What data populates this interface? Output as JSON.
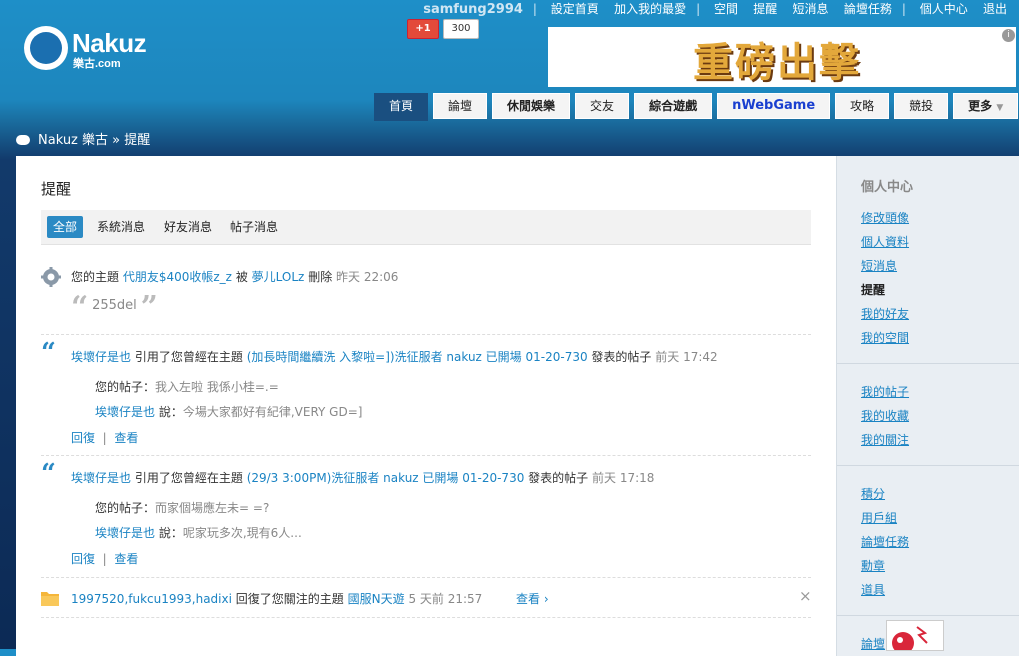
{
  "header": {
    "logo_text": "Nakuz",
    "logo_sub": "樂古.com",
    "user": "samfung2994",
    "links": [
      "設定首頁",
      "加入我的最愛",
      "空間",
      "提醒",
      "短消息",
      "論壇任務",
      "個人中心",
      "退出"
    ],
    "gplus_label": "+1",
    "gplus_count": "300",
    "banner_text": "重磅出擊",
    "banner_info": "i"
  },
  "tabs": [
    {
      "label": "首頁",
      "active": true
    },
    {
      "label": "論壇"
    },
    {
      "label": "休閒娛樂"
    },
    {
      "label": "交友"
    },
    {
      "label": "綜合遊戲"
    },
    {
      "label": "nWebGame"
    },
    {
      "label": "攻略"
    },
    {
      "label": "競投"
    },
    {
      "label": "更多"
    }
  ],
  "breadcrumb": {
    "site": "Nakuz 樂古",
    "sep": "»",
    "current": "提醒"
  },
  "page": {
    "title": "提醒",
    "filters": [
      "全部",
      "系統消息",
      "好友消息",
      "帖子消息"
    ]
  },
  "notifications": [
    {
      "prefix": "您的主題",
      "topic": "代朋友$400收帳z_z",
      "by_word": "被",
      "user": "夢儿LOLz",
      "action": "刪除",
      "time": "昨天 22:06",
      "quote": "255del"
    },
    {
      "user": "埃壞仔是也",
      "text1": "引用了您曾經在主題",
      "topic": "(加長時間繼續洗 入黎啦=])洗征服者 nakuz 已開場 01-20-730",
      "text2": "發表的帖子",
      "time": "前天 17:42",
      "your_post_label": "您的帖子：",
      "your_post": "我入左啦 我係小桂=.=",
      "reply_user": "埃壞仔是也",
      "said": "說：",
      "reply": "今場大家都好有紀律,VERY GD=]",
      "reply_link": "回復",
      "view_link": "查看"
    },
    {
      "user": "埃壞仔是也",
      "text1": "引用了您曾經在主題",
      "topic": "(29/3 3:00PM)洗征服者 nakuz 已開場 01-20-730",
      "text2": "發表的帖子",
      "time": "前天 17:18",
      "your_post_label": "您的帖子：",
      "your_post": "而家個場應左未= =?",
      "reply_user": "埃壞仔是也",
      "said": "說：",
      "reply": "呢家玩多次,現有6人...",
      "reply_link": "回復",
      "view_link": "查看"
    },
    {
      "users": "1997520,fukcu1993,hadixi",
      "text1": "回復了您關注的主題",
      "topic": "國服N天遊",
      "time": "5 天前 21:57",
      "view_link": "查看 ›",
      "close": "×"
    }
  ],
  "sidebar": {
    "title": "個人中心",
    "group1": [
      "修改頭像",
      "個人資料",
      "短消息",
      "提醒",
      "我的好友",
      "我的空間"
    ],
    "group2": [
      "我的帖子",
      "我的收藏",
      "我的關注"
    ],
    "group3": [
      "積分",
      "用戶組",
      "論壇任務",
      "勳章",
      "道具"
    ],
    "group4_first": "論壇"
  },
  "colors": {
    "link": "#1a83c3",
    "active_tab": "#1a4f80",
    "filter_active": "#2b8ac4"
  }
}
